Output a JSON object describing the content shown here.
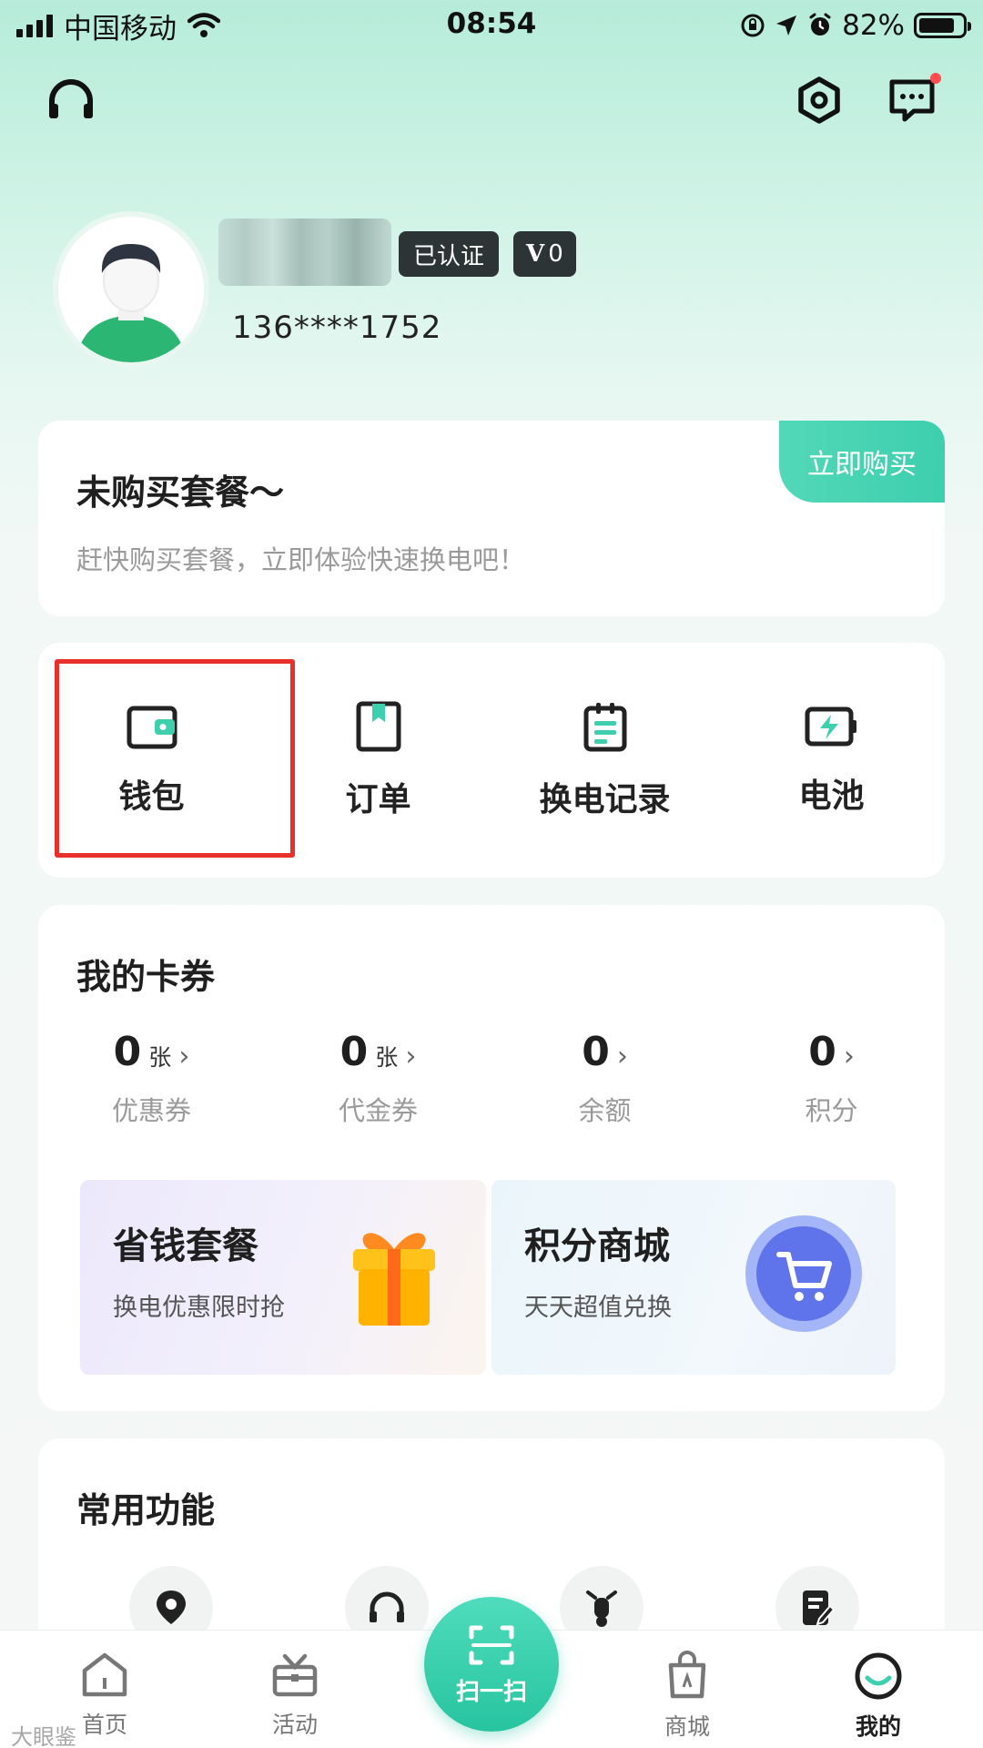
{
  "status_bar": {
    "carrier": "中国移动",
    "time": "08:54",
    "battery": "82%",
    "battery_level": 0.82
  },
  "profile": {
    "verified_badge": "已认证",
    "level_badge_letter": "V",
    "level_badge_value": "0",
    "phone": "136****1752"
  },
  "package": {
    "title": "未购买套餐～",
    "subtitle": "赶快购买套餐，立即体验快速换电吧！",
    "buy_label": "立即购买"
  },
  "quick_actions": [
    {
      "label": "钱包",
      "icon": "wallet-icon"
    },
    {
      "label": "订单",
      "icon": "bookmark-order-icon"
    },
    {
      "label": "换电记录",
      "icon": "clipboard-record-icon"
    },
    {
      "label": "电池",
      "icon": "battery-charge-icon"
    }
  ],
  "coupons": {
    "title": "我的卡券",
    "stats": [
      {
        "value": "0",
        "unit": "张",
        "label": "优惠券"
      },
      {
        "value": "0",
        "unit": "张",
        "label": "代金券"
      },
      {
        "value": "0",
        "unit": "",
        "label": "余额"
      },
      {
        "value": "0",
        "unit": "",
        "label": "积分"
      }
    ],
    "promos": [
      {
        "title": "省钱套餐",
        "subtitle": "换电优惠限时抢",
        "icon": "gift-icon"
      },
      {
        "title": "积分商城",
        "subtitle": "天天超值兑换",
        "icon": "shopping-cart-icon"
      }
    ]
  },
  "common": {
    "title": "常用功能",
    "icons": [
      "location-pin-icon",
      "headset-icon",
      "scooter-icon",
      "edit-document-icon"
    ]
  },
  "tabbar": {
    "items": [
      {
        "label": "首页",
        "icon": "home-icon"
      },
      {
        "label": "活动",
        "icon": "activity-icon"
      },
      {
        "label": "商城",
        "icon": "shopping-bag-icon"
      },
      {
        "label": "我的",
        "icon": "profile-smile-icon"
      }
    ],
    "scan_label": "扫一扫"
  },
  "watermark": "大眼鉴",
  "colors": {
    "accent": "#3dcfae",
    "highlight": "#e8302b",
    "badge": "#2d3436"
  }
}
